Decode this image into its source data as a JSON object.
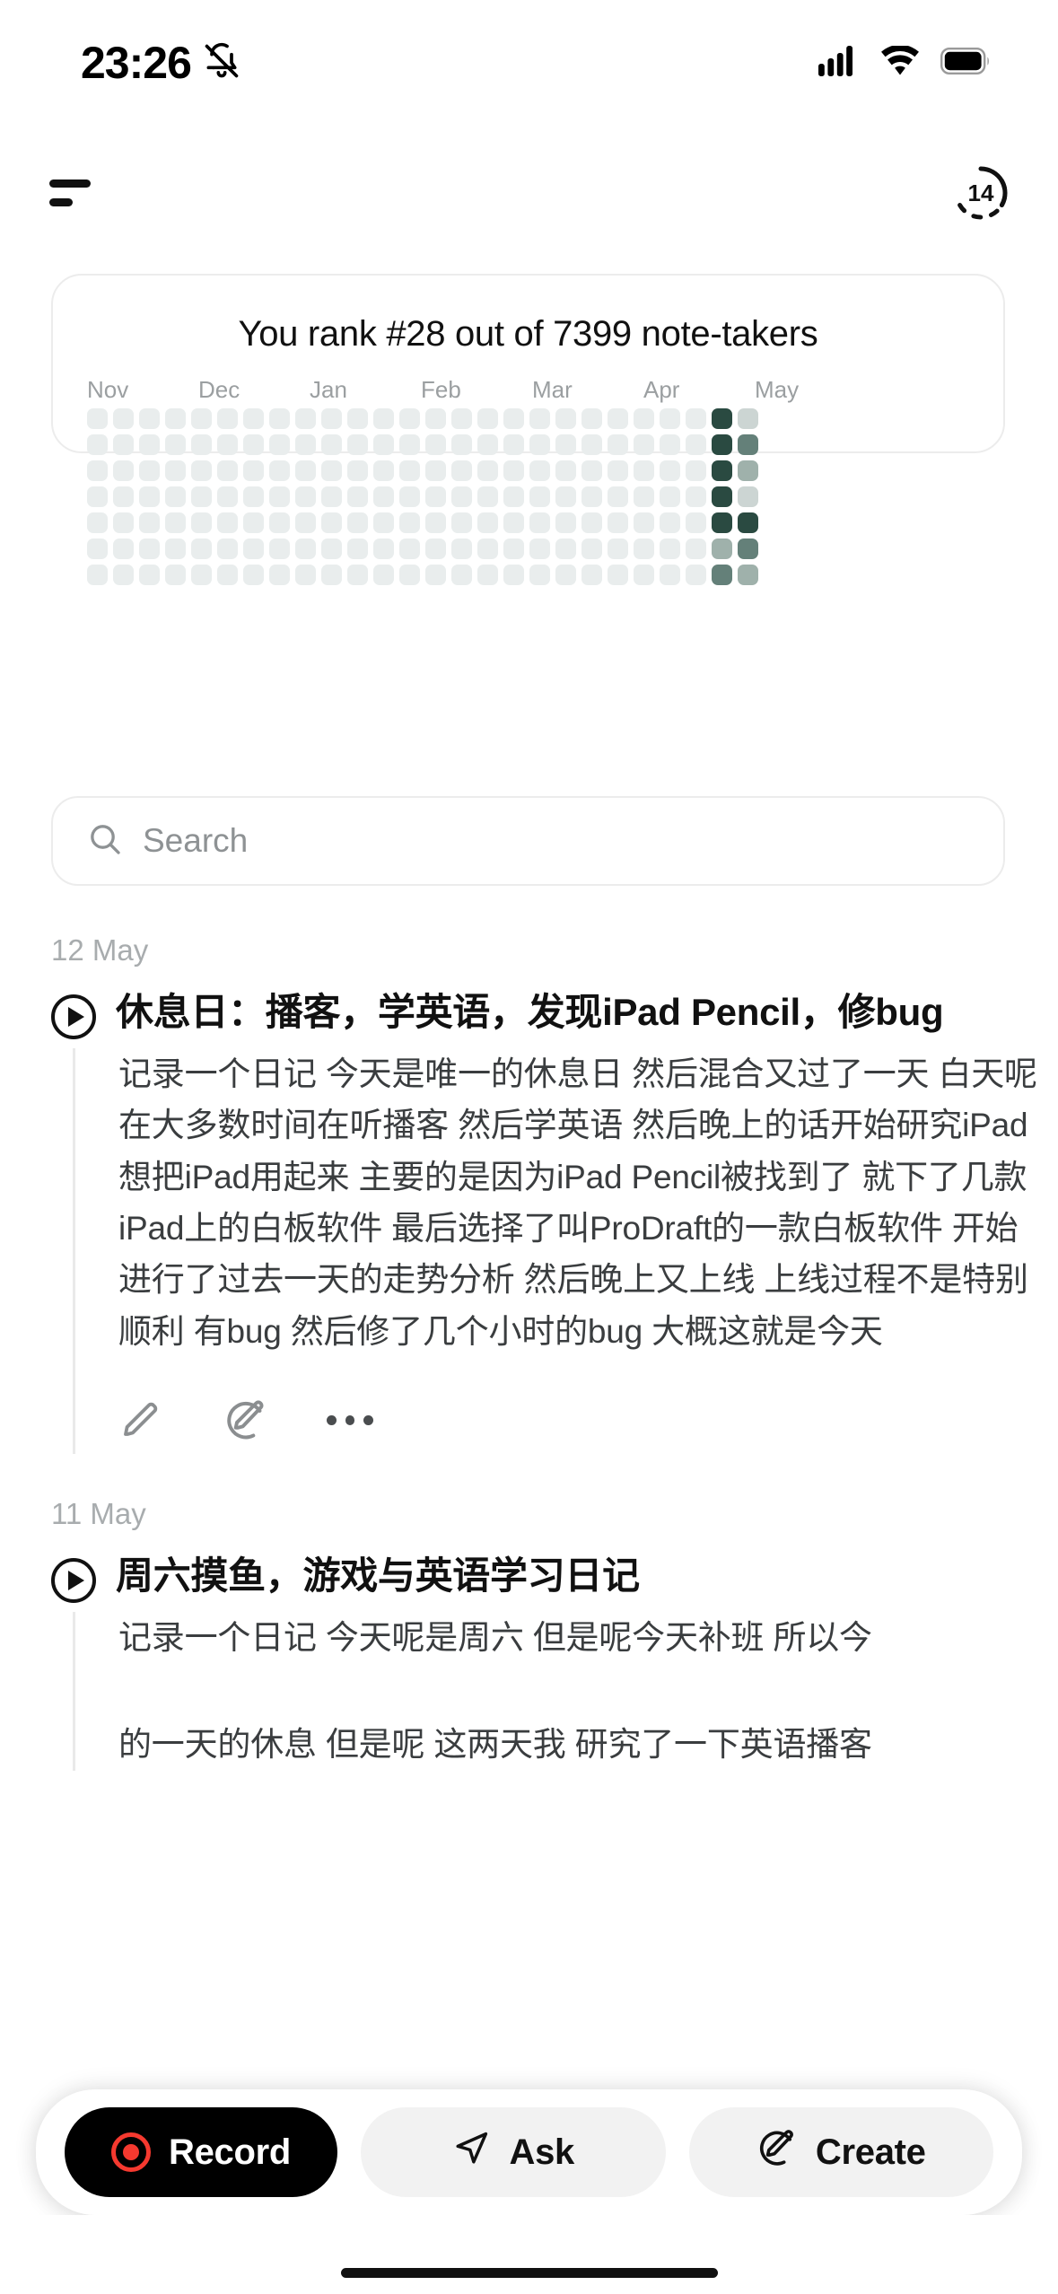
{
  "status_bar": {
    "time": "23:26",
    "icons": [
      "bell-slash-icon",
      "cellular-signal-icon",
      "wifi-icon",
      "battery-icon"
    ]
  },
  "nav": {
    "menu_icon": "hamburger-menu-icon",
    "progress_badge": "14"
  },
  "stats": {
    "rank_text": "You rank #28 out of 7399 note-takers",
    "months": [
      "Nov",
      "Dec",
      "Jan",
      "Feb",
      "Mar",
      "Apr",
      "May"
    ],
    "colors": {
      "empty": "#e9eded",
      "l1": "#ccd5d3",
      "l2": "#9fb1ab",
      "l3": "#648079",
      "l4": "#2a4a41"
    }
  },
  "chart_data": {
    "type": "heatmap",
    "title": "You rank #28 out of 7399 note-takers",
    "xlabel": "",
    "ylabel": "",
    "categories": [
      "Nov",
      "Dec",
      "Jan",
      "Feb",
      "Mar",
      "Apr",
      "May"
    ],
    "rows": 7,
    "columns": 26,
    "legend": [
      "0",
      "1",
      "2",
      "3",
      "4"
    ],
    "values": [
      [
        0,
        0,
        0,
        0,
        0,
        0,
        0,
        0,
        0,
        0,
        0,
        0,
        0,
        0,
        0,
        0,
        0,
        0,
        0,
        0,
        0,
        0,
        0,
        0,
        4,
        1
      ],
      [
        0,
        0,
        0,
        0,
        0,
        0,
        0,
        0,
        0,
        0,
        0,
        0,
        0,
        0,
        0,
        0,
        0,
        0,
        0,
        0,
        0,
        0,
        0,
        0,
        4,
        3
      ],
      [
        0,
        0,
        0,
        0,
        0,
        0,
        0,
        0,
        0,
        0,
        0,
        0,
        0,
        0,
        0,
        0,
        0,
        0,
        0,
        0,
        0,
        0,
        0,
        0,
        4,
        2
      ],
      [
        0,
        0,
        0,
        0,
        0,
        0,
        0,
        0,
        0,
        0,
        0,
        0,
        0,
        0,
        0,
        0,
        0,
        0,
        0,
        0,
        0,
        0,
        0,
        0,
        4,
        1
      ],
      [
        0,
        0,
        0,
        0,
        0,
        0,
        0,
        0,
        0,
        0,
        0,
        0,
        0,
        0,
        0,
        0,
        0,
        0,
        0,
        0,
        0,
        0,
        0,
        0,
        4,
        4
      ],
      [
        0,
        0,
        0,
        0,
        0,
        0,
        0,
        0,
        0,
        0,
        0,
        0,
        0,
        0,
        0,
        0,
        0,
        0,
        0,
        0,
        0,
        0,
        0,
        0,
        2,
        3
      ],
      [
        0,
        0,
        0,
        0,
        0,
        0,
        0,
        0,
        0,
        0,
        0,
        0,
        0,
        0,
        0,
        0,
        0,
        0,
        0,
        0,
        0,
        0,
        0,
        0,
        3,
        2
      ]
    ]
  },
  "search": {
    "placeholder": "Search",
    "value": "",
    "icon": "search-icon"
  },
  "notes": [
    {
      "date": "12 May",
      "title": "休息日：播客，学英语，发现iPad Pencil，修bug",
      "body": "记录一个日记 今天是唯一的休息日 然后混合又过了一天 白天呢 在大多数时间在听播客 然后学英语 然后晚上的话开始研究iPad 想把iPad用起来 主要的是因为iPad Pencil被找到了 就下了几款iPad上的白板软件 最后选择了叫ProDraft的一款白板软件 开始进行了过去一天的走势分析 然后晚上又上线 上线过程不是特别顺利 有bug 然后修了几个小时的bug 大概这就是今天",
      "actions": [
        "edit-icon",
        "magic-create-icon",
        "more-options-icon"
      ]
    },
    {
      "date": "11 May",
      "title": "周六摸鱼，游戏与英语学习日记",
      "body": "记录一个日记 今天呢是周六 但是呢今天补班 所以今",
      "body_tail_1": "的一天的休息 但是呢 这两天我 研究了一下英语播客",
      "actions": []
    }
  ],
  "toolbar": {
    "record_label": "Record",
    "record_icon": "record-dot-icon",
    "ask_label": "Ask",
    "ask_icon": "send-paper-plane-icon",
    "create_label": "Create",
    "create_icon": "magic-create-icon"
  }
}
